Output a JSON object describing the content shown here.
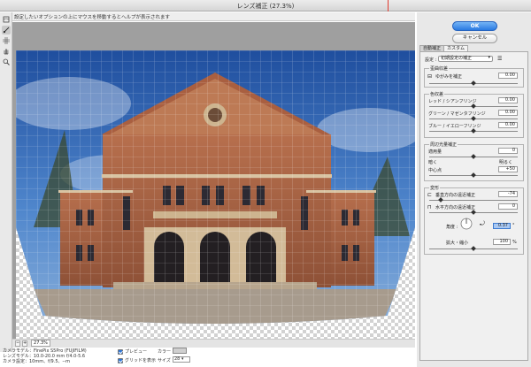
{
  "window": {
    "title": "レンズ補正 (27.3%)"
  },
  "help_text": "設定したいオプションの上にマウスを移動するとヘルプが表示されます",
  "tools": [
    "remove-distortion-tool",
    "straighten-tool",
    "move-grid-tool",
    "hand-tool",
    "zoom-tool"
  ],
  "zoom": {
    "value": "27.3%",
    "minus": "−",
    "plus": "+"
  },
  "camera_info": {
    "line1": "カメラモデル：FinePix S5Pro (FUJIFILM)",
    "line2": "レンズモデル：10.0-20.0 mm f/4.0-5.6",
    "line3": "カメラ設定：10mm、f/9.5、--m"
  },
  "bottom": {
    "preview_label": "プレビュー",
    "grid_label": "グリッドを表示",
    "color_label": "カラー :",
    "size_label": "サイズ :",
    "size_value": "28"
  },
  "buttons": {
    "ok": "OK",
    "cancel": "キャンセル"
  },
  "tabs": {
    "auto": "自動補正",
    "custom": "カスタム"
  },
  "settings": {
    "label": "設定 :",
    "value": "初期設定の補正"
  },
  "geometric": {
    "title": "歪曲収差",
    "remove_distortion_label": "ゆがみを補正",
    "remove_distortion_value": "0.00"
  },
  "chromatic": {
    "title": "色収差",
    "red_cyan_label": "レッド / シアンフリンジ",
    "red_cyan_value": "0.00",
    "green_magenta_label": "グリーン / マゼンタフリンジ",
    "green_magenta_value": "0.00",
    "blue_yellow_label": "ブルー / イエローフリンジ",
    "blue_yellow_value": "0.00"
  },
  "vignette": {
    "title": "周辺光量補正",
    "amount_label": "適用量",
    "amount_value": "0",
    "darken_label": "暗く",
    "lighten_label": "明るく",
    "midpoint_label": "中心点",
    "midpoint_value": "+50"
  },
  "transform": {
    "title": "変形",
    "vertical_label": "垂直方向の遠近補正",
    "vertical_value": "-74",
    "horizontal_label": "水平方向の遠近補正",
    "horizontal_value": "0",
    "angle_label": "角度 :",
    "angle_value": "0.37",
    "angle_unit": "°",
    "scale_label": "拡大・縮小",
    "scale_value": "100",
    "scale_unit": "%"
  },
  "colors": {
    "accent": "#2a7ae2",
    "red_marker": "#e23b2f"
  }
}
